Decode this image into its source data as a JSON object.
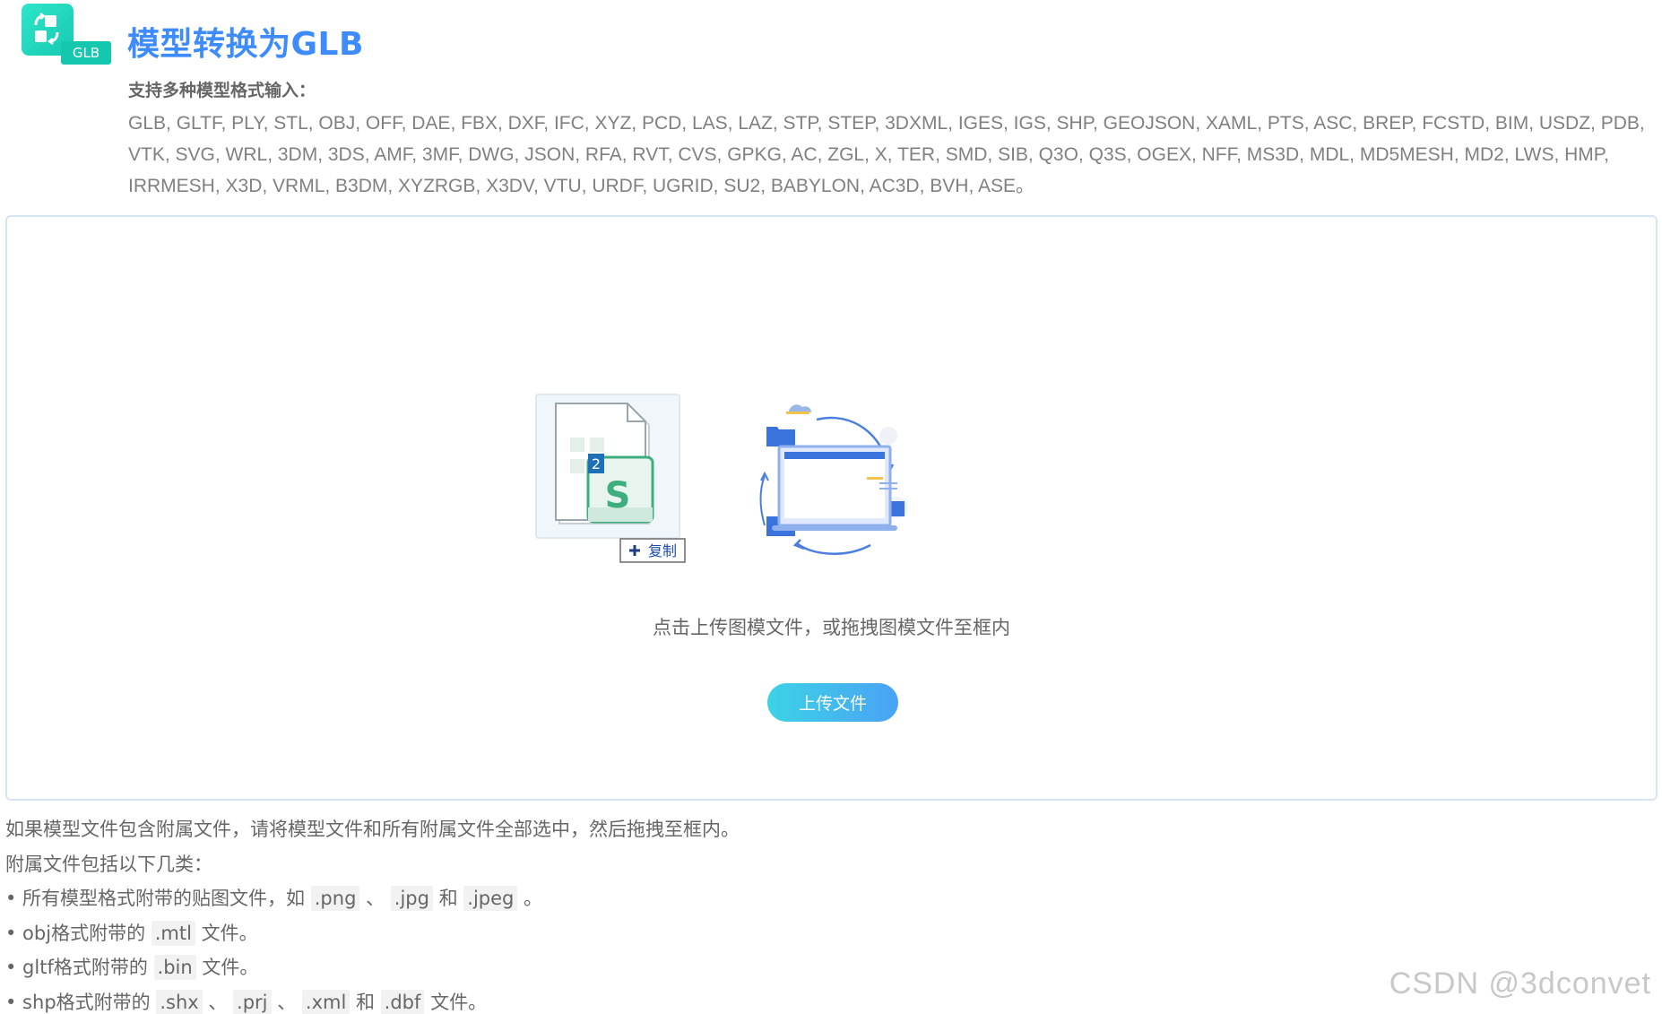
{
  "header": {
    "logo_tag": "GLB",
    "title": "模型转换为GLB",
    "formats_label": "支持多种模型格式输入：",
    "formats_line1": "GLB, GLTF, PLY, STL, OBJ, OFF, DAE, FBX, DXF, IFC, XYZ, PCD, LAS, LAZ, STP, STEP, 3DXML, IGES, IGS, SHP, GEOJSON, XAML, PTS, ASC, BREP, FCSTD, BIM, USDZ, PDB,",
    "formats_line2": "VTK, SVG, WRL, 3DM, 3DS, AMF, 3MF, DWG, JSON, RFA, RVT, CVS, GPKG, AC, ZGL, X, TER, SMD, SIB, Q3O, Q3S, OGEX, NFF, MS3D, MDL, MD5MESH, MD2, LWS, HMP,",
    "formats_line3": "IRRMESH, X3D, VRML, B3DM, XYZRGB, X3DV, VTU, URDF, UGRID, SU2, BABYLON, AC3D, BVH, ASE。"
  },
  "upload": {
    "badge_number": "2",
    "badge_letter": "S",
    "copy_label": "复制",
    "hint": "点击上传图模文件，或拖拽图模文件至框内",
    "button_label": "上传文件"
  },
  "notes": {
    "line1": "如果模型文件包含附属文件，请将模型文件和所有附属文件全部选中，然后拖拽至框内。",
    "line2": "附属文件包括以下几类：",
    "line3": {
      "prefix": "• 所有模型格式附带的贴图文件，如 ",
      "c1": ".png",
      "sep1": " 、 ",
      "c2": ".jpg",
      "sep2": " 和 ",
      "c3": ".jpeg",
      "suffix": " 。"
    },
    "line4": {
      "prefix": "• obj格式附带的 ",
      "c1": ".mtl",
      "suffix": " 文件。"
    },
    "line5": {
      "prefix": "• gltf格式附带的 ",
      "c1": ".bin",
      "suffix": " 文件。"
    },
    "line6": {
      "prefix": "• shp格式附带的 ",
      "c1": ".shx",
      "sep1": " 、 ",
      "c2": ".prj",
      "sep2": " 、 ",
      "c3": ".xml",
      "sep3": " 和 ",
      "c4": ".dbf",
      "suffix": " 文件。"
    }
  },
  "watermark": "CSDN @3dconvet",
  "colors": {
    "title": "#3d8bfd",
    "logo": "#17c9b3",
    "button_start": "#3cd3e6",
    "button_end": "#4aa2f4",
    "border": "#d9e4f2"
  }
}
